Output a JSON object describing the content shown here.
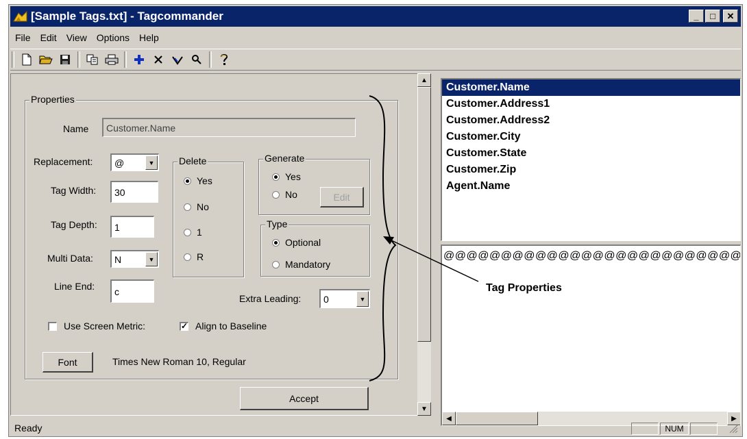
{
  "window": {
    "title": "[Sample Tags.txt] - Tagcommander",
    "minimize_icon": "minimize-icon",
    "maximize_icon": "maximize-icon",
    "close_icon": "close-icon"
  },
  "menu": {
    "items": [
      "File",
      "Edit",
      "View",
      "Options",
      "Help"
    ]
  },
  "toolbar": {
    "icons": [
      "new-file-icon",
      "open-folder-icon",
      "save-disk-icon",
      "copy-icon",
      "print-icon",
      "add-plus-icon",
      "delete-x-icon",
      "edit-bracket-icon",
      "search-magnifier-icon",
      "help-question-icon"
    ]
  },
  "properties": {
    "group_label": "Properties",
    "name_label": "Name",
    "name_value": "Customer.Name",
    "replacement_label": "Replacement:",
    "replacement_value": "@",
    "tag_width_label": "Tag Width:",
    "tag_width_value": "30",
    "tag_depth_label": "Tag Depth:",
    "tag_depth_value": "1",
    "multi_data_label": "Multi Data:",
    "multi_data_value": "N",
    "line_end_label": "Line End:",
    "line_end_value": "c",
    "delete": {
      "label": "Delete",
      "options": [
        "Yes",
        "No",
        "1",
        "R"
      ],
      "selected": "Yes"
    },
    "generate": {
      "label": "Generate",
      "options": [
        "Yes",
        "No"
      ],
      "selected": "Yes",
      "edit_label": "Edit"
    },
    "type": {
      "label": "Type",
      "options": [
        "Optional",
        "Mandatory"
      ],
      "selected": "Optional"
    },
    "extra_leading_label": "Extra Leading:",
    "extra_leading_value": "0",
    "use_screen_metric_label": "Use Screen Metric:",
    "use_screen_metric_checked": false,
    "align_baseline_label": "Align to Baseline",
    "align_baseline_checked": true,
    "font_button_label": "Font",
    "font_value": "Times New Roman 10, Regular",
    "accept_label": "Accept"
  },
  "tag_list": {
    "items": [
      "Customer.Name",
      "Customer.Address1",
      "Customer.Address2",
      "Customer.City",
      "Customer.State",
      "Customer.Zip",
      "Agent.Name"
    ],
    "selected": "Customer.Name"
  },
  "preview": {
    "text": "@@@@@@@@@@@@@@@@@@@@@@@@@@@@@@"
  },
  "callout": {
    "label": "Tag Properties"
  },
  "status": {
    "text": "Ready",
    "num_indicator": "NUM"
  }
}
